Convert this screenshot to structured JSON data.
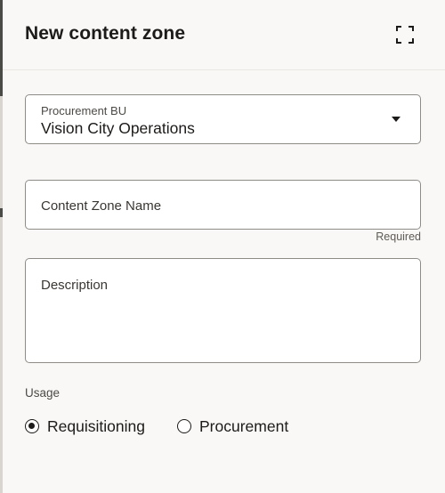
{
  "drawer": {
    "title": "New content zone",
    "expand_icon": "expand-icon"
  },
  "form": {
    "procurement_bu": {
      "label": "Procurement BU",
      "value": "Vision City Operations",
      "icon": "dropdown-arrow-icon"
    },
    "content_zone_name": {
      "placeholder": "Content Zone Name",
      "value": "",
      "hint": "Required"
    },
    "description": {
      "placeholder": "Description",
      "value": ""
    },
    "usage": {
      "label": "Usage",
      "options": [
        {
          "label": "Requisitioning",
          "selected": true
        },
        {
          "label": "Procurement",
          "selected": false
        }
      ]
    }
  },
  "colors": {
    "drawer_background": "#f9f8f6",
    "field_border": "#8f8c87",
    "text": "#1d1b19",
    "backdrop": "#4a4a46"
  }
}
